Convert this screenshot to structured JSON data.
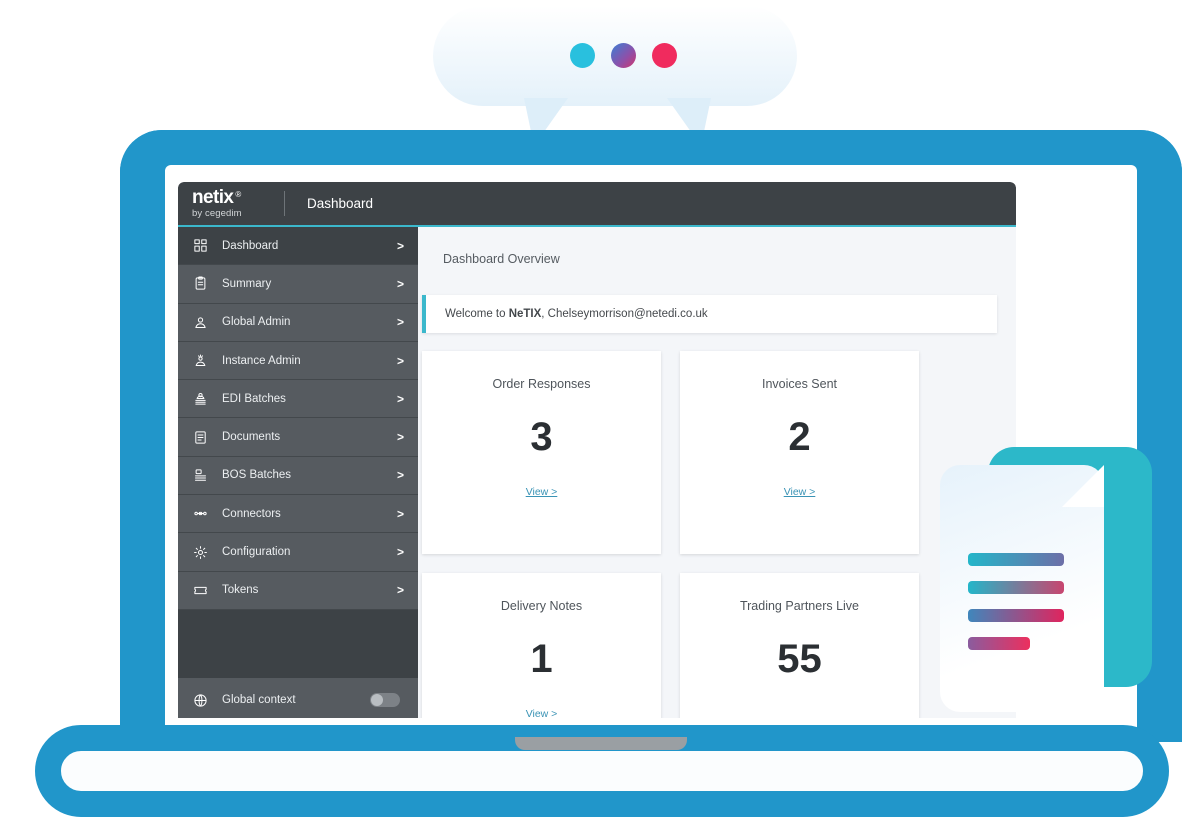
{
  "brand": {
    "name": "netix",
    "registered_mark": "®",
    "tagline": "by cegedim"
  },
  "header": {
    "title": "Dashboard"
  },
  "sidebar": {
    "items": [
      {
        "label": "Dashboard",
        "icon": "grid-icon",
        "chevron": ">",
        "active": true
      },
      {
        "label": "Summary",
        "icon": "clipboard-icon",
        "chevron": ">",
        "active": false
      },
      {
        "label": "Global Admin",
        "icon": "user-icon",
        "chevron": ">",
        "active": false
      },
      {
        "label": "Instance Admin",
        "icon": "user-gear-icon",
        "chevron": ">",
        "active": false
      },
      {
        "label": "EDI Batches",
        "icon": "user-lines-icon",
        "chevron": ">",
        "active": false
      },
      {
        "label": "Documents",
        "icon": "document-icon",
        "chevron": ">",
        "active": false
      },
      {
        "label": "BOS Batches",
        "icon": "batch-lines-icon",
        "chevron": ">",
        "active": false
      },
      {
        "label": "Connectors",
        "icon": "connector-icon",
        "chevron": ">",
        "active": false
      },
      {
        "label": "Configuration",
        "icon": "gear-icon",
        "chevron": ">",
        "active": false
      },
      {
        "label": "Tokens",
        "icon": "ticket-icon",
        "chevron": ">",
        "active": false
      }
    ],
    "footer": {
      "label": "Global context",
      "icon": "globe-icon",
      "toggle_state": "off"
    }
  },
  "main": {
    "page_heading": "Dashboard Overview",
    "welcome": {
      "prefix": "Welcome to ",
      "product": "NeTIX",
      "suffix": ", Chelseymorrison@netedi.co.uk"
    },
    "cards": [
      {
        "title": "Order Responses",
        "value": "3",
        "link": "View >",
        "badge": false
      },
      {
        "title": "Invoices Sent",
        "value": "2",
        "link": "View >",
        "badge": false
      },
      {
        "title": "Delivery Notes",
        "value": "1",
        "link": "View >",
        "badge": false
      },
      {
        "title": "Trading Partners Live",
        "value": "55",
        "link": "",
        "badge": true
      }
    ]
  },
  "decoration": {
    "speech_bubble": {
      "dots": [
        {
          "name": "dot-cyan",
          "color": "#29c0de"
        },
        {
          "name": "dot-gradient",
          "color": "#4a7fc1"
        },
        {
          "name": "dot-pink",
          "color": "#f02b5e"
        }
      ]
    },
    "document_icon": {
      "back_color": "#2cb8c9",
      "bar_count": 4
    }
  },
  "colors": {
    "laptop_blue": "#2196ca",
    "header_dark": "#3d4246",
    "sidebar_gray": "#565b60",
    "accent_teal": "#3bb8cc",
    "link_blue": "#3a93b5"
  }
}
